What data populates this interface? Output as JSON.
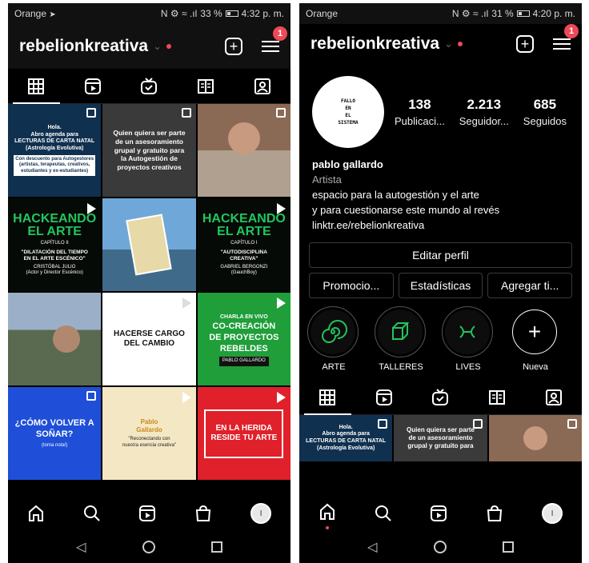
{
  "left": {
    "status": {
      "carrier": "Orange",
      "icons": "N ⚙ ≈ .ıl",
      "battery": "33 %",
      "time": "4:32 p. m."
    },
    "username": "rebelionkreativa",
    "badge": "1",
    "posts": [
      {
        "title": "Hola.\nAbro agenda para\nLECTURAS DE CARTA NATAL\n(Astrología Evolutiva)",
        "sub": "Con descuento para Autogestores\n(artistas, terapeutas, creativos,\nestudiantes y ex-estudiantes)"
      },
      {
        "title": "Quien quiera ser parte\nde un asesoramiento\ngrupal y gratuito para\nla Autogestión de\nproyectos creativos"
      },
      {
        "title": ""
      },
      {
        "title": "HACKEANDO\nEL ARTE",
        "cap": "CAPÍTULO II",
        "sub": "\"DILATACIÓN DEL TIEMPO\nEN EL ARTE ESCÉNICO\"",
        "guest": "CRISTÓBAL JULIO\n(Actor y Director Escénico)"
      },
      {
        "title": ""
      },
      {
        "title": "HACKEANDO\nEL ARTE",
        "cap": "CAPÍTULO I",
        "sub": "\"AUTODISCIPLINA\nCREATIVA\"",
        "guest": "GABRIEL BERGONZI\n(GauchBoy)"
      },
      {
        "title": ""
      },
      {
        "title": "HACERSE CARGO\nDEL CAMBIO"
      },
      {
        "title": "CO-CREACIÓN\nDE PROYECTOS\nREBELDES",
        "cap": "CHARLA EN VIVO",
        "sub": "PABLO GALLARDO"
      },
      {
        "title": "¿CÓMO VOLVER A\nSOÑAR?",
        "sub": "(toma nota!)"
      },
      {
        "title": "Pablo\nGallardo",
        "sub": "\"Reconectando con\nnuestra esencia creativa\""
      },
      {
        "title": "EN LA HERIDA\nRESIDE TU ARTE"
      }
    ]
  },
  "right": {
    "status": {
      "carrier": "Orange",
      "icons": "N ⚙ ≈ .ıl",
      "battery": "31 %",
      "time": "4:20 p. m."
    },
    "username": "rebelionkreativa",
    "badge": "1",
    "avatar_text": "FALLO\nEN\nEL\nSISTEMA",
    "stats": [
      {
        "num": "138",
        "label": "Publicaci..."
      },
      {
        "num": "2.213",
        "label": "Seguidor..."
      },
      {
        "num": "685",
        "label": "Seguidos"
      }
    ],
    "name": "pablo gallardo",
    "category": "Artista",
    "bio1": "espacio para la autogestión y el arte",
    "bio2": "y para cuestionarse este mundo al revés",
    "link": "linktr.ee/rebelionkreativa",
    "edit_profile": "Editar perfil",
    "buttons": [
      "Promocio...",
      "Estadísticas",
      "Agregar ti..."
    ],
    "highlights": [
      {
        "label": "ARTE"
      },
      {
        "label": "TALLERES"
      },
      {
        "label": "LIVES"
      },
      {
        "label": "Nueva"
      }
    ],
    "mini_posts": [
      {
        "title": "Hola.\nAbro agenda para\nLECTURAS DE CARTA NATAL\n(Astrología Evolutiva)"
      },
      {
        "title": "Quien quiera ser parte\nde un asesoramiento\ngrupal y gratuito para"
      },
      {
        "title": ""
      }
    ]
  },
  "colors": {
    "accent_red": "#ed4956",
    "hack_green": "#22c55e",
    "blue": "#1f4fd8",
    "red_post": "#e0202a"
  }
}
